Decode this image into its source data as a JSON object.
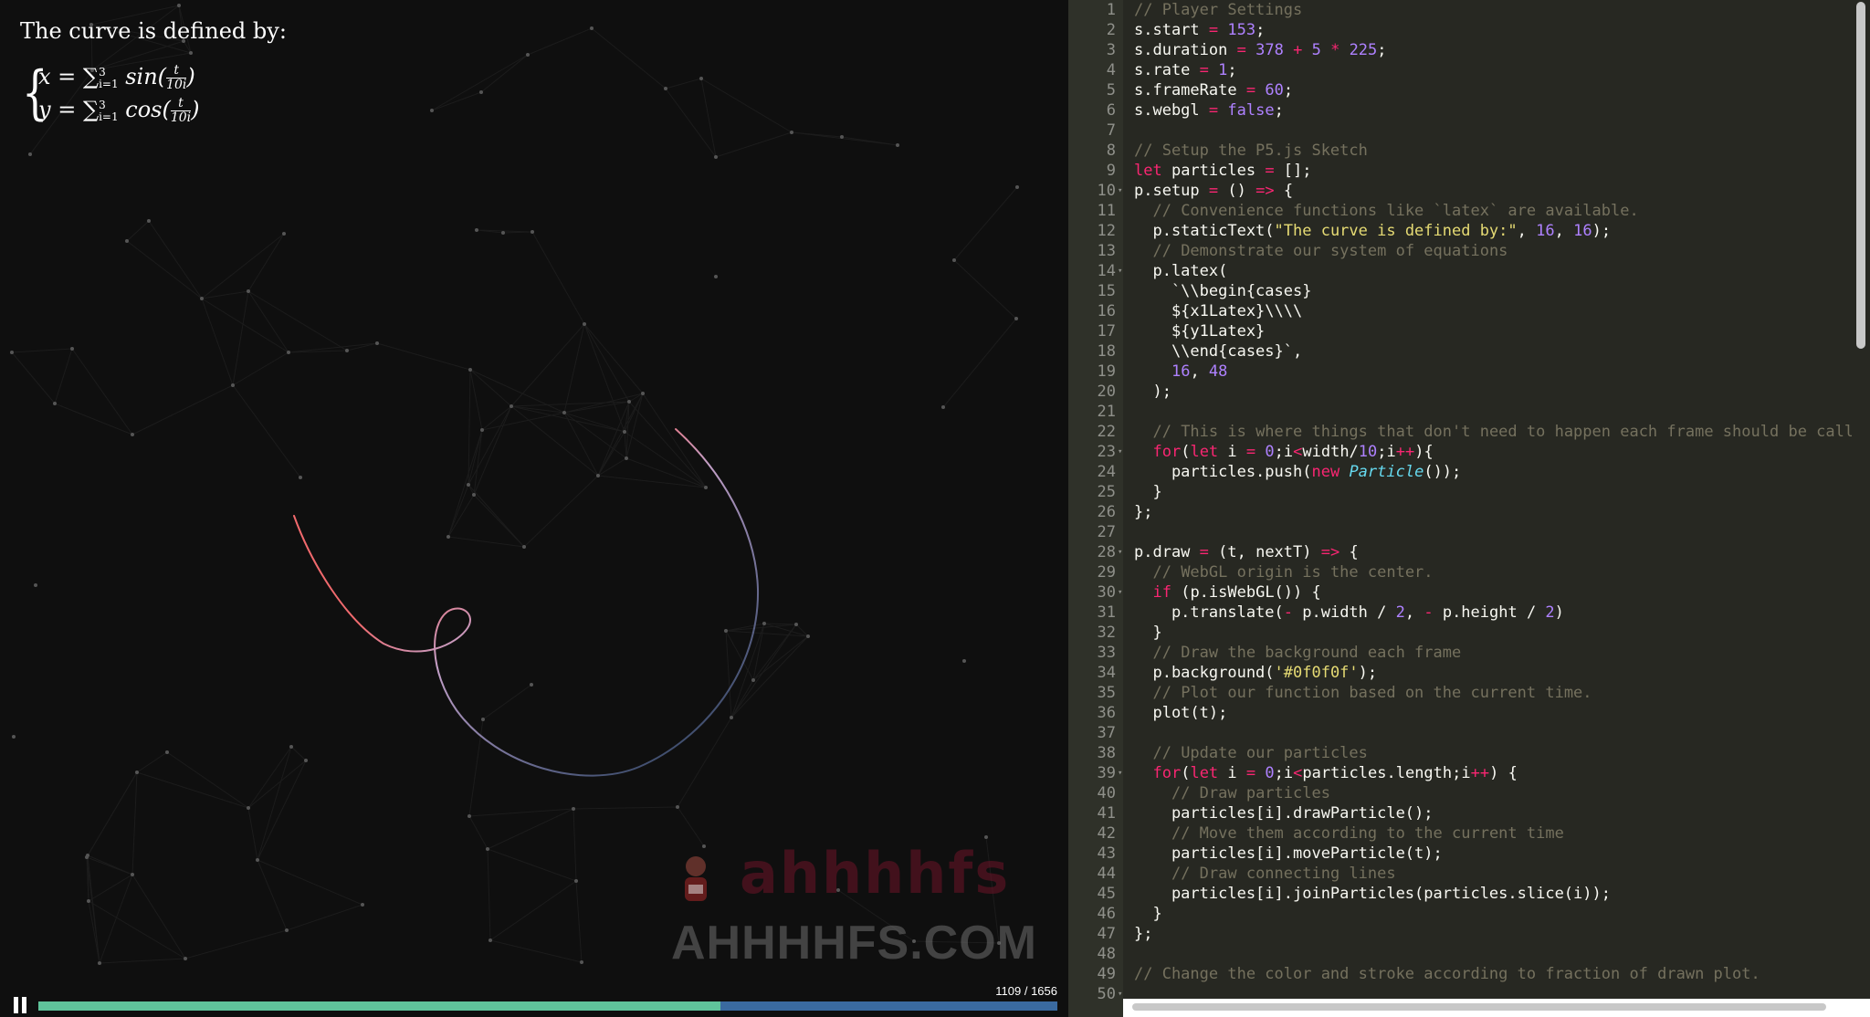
{
  "sketch": {
    "static_text": "The curve is defined by:",
    "latex": {
      "x_lhs": "x =",
      "x_fn": "sin(",
      "y_lhs": "y =",
      "y_fn": "cos(",
      "sum_symbol": "∑",
      "sum_upper": "3",
      "sum_lower": "i=1",
      "frac_num": "t",
      "frac_den": "10i",
      "close_paren": ")"
    },
    "watermark_top": "ahhhhfs",
    "watermark_bottom": "AHHHHFS.COM"
  },
  "player": {
    "frame_counter": "1109 / 1656",
    "progress_fraction": 0.6697
  },
  "colors": {
    "canvas_bg": "#0f0f0f",
    "curve_start": "#f2686b",
    "curve_end": "#5a8fd8",
    "progress_fill": "#5fc39a",
    "progress_track": "#3a6aa0",
    "editor_bg": "#272822"
  },
  "editor": {
    "line_numbers": [
      "1",
      "2",
      "3",
      "4",
      "5",
      "6",
      "7",
      "8",
      "9",
      "10",
      "11",
      "12",
      "13",
      "14",
      "15",
      "16",
      "17",
      "18",
      "19",
      "20",
      "21",
      "22",
      "23",
      "24",
      "25",
      "26",
      "27",
      "28",
      "29",
      "30",
      "31",
      "32",
      "33",
      "34",
      "35",
      "36",
      "37",
      "38",
      "39",
      "40",
      "41",
      "42",
      "43",
      "44",
      "45",
      "46",
      "47",
      "48",
      "49",
      "50"
    ],
    "fold_markers": [
      "10",
      "14",
      "23",
      "28",
      "30",
      "39",
      "50"
    ],
    "lines": [
      "// Player Settings",
      "s.start = 153;",
      "s.duration = 378 + 5 * 225;",
      "s.rate = 1;",
      "s.frameRate = 60;",
      "s.webgl = false;",
      "",
      "// Setup the P5.js Sketch",
      "let particles = [];",
      "p.setup = () => {",
      "  // Convenience functions like `latex` are available.",
      "  p.staticText(\"The curve is defined by:\", 16, 16);",
      "  // Demonstrate our system of equations",
      "  p.latex(",
      "    `\\\\begin{cases}",
      "    ${x1Latex}\\\\\\\\",
      "    ${y1Latex}",
      "    \\\\end{cases}`,",
      "    16, 48",
      "  );",
      "",
      "  // This is where things that don't need to happen each frame should be called",
      "  for(let i = 0;i<width/10;i++){",
      "    particles.push(new Particle());",
      "  }",
      "};",
      "",
      "p.draw = (t, nextT) => {",
      "  // WebGL origin is the center.",
      "  if (p.isWebGL()) {",
      "    p.translate(- p.width / 2, - p.height / 2)",
      "  }",
      "  // Draw the background each frame",
      "  p.background('#0f0f0f');",
      "  // Plot our function based on the current time.",
      "  plot(t);",
      "",
      "  // Update our particles",
      "  for(let i = 0;i<particles.length;i++) {",
      "    // Draw particles",
      "    particles[i].drawParticle();",
      "    // Move them according to the current time",
      "    particles[i].moveParticle(t);",
      "    // Draw connecting lines",
      "    particles[i].joinParticles(particles.slice(i));",
      "  }",
      "};",
      "",
      "// Change the color and stroke according to fraction of drawn plot.",
      ""
    ]
  }
}
